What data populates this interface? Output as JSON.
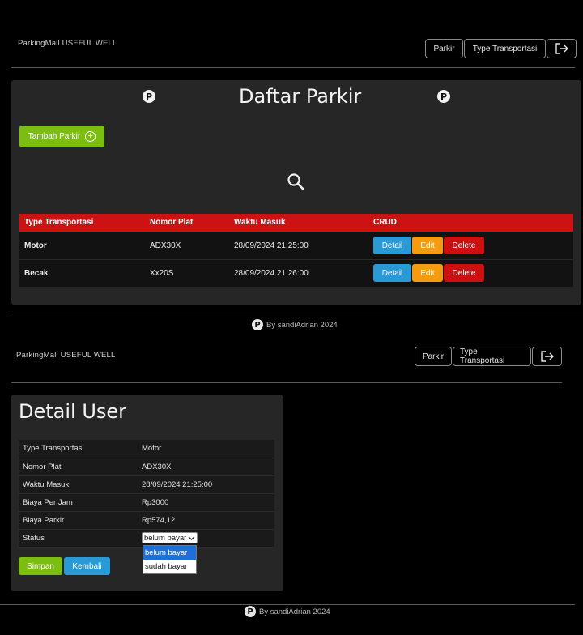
{
  "top": {
    "brand": "ParkingMall USEFUL WELL",
    "nav": {
      "parkir": "Parkir",
      "type": "Type Transportasi",
      "logout_icon": "logout-icon"
    },
    "title": "Daftar Parkir",
    "add_button": "Tambah Parkir",
    "search_icon": "search-icon",
    "table": {
      "headers": [
        "Type Transportasi",
        "Nomor Plat",
        "Waktu Masuk",
        "CRUD"
      ],
      "rows": [
        {
          "type": "Motor",
          "plate": "ADX30X",
          "time": "28/09/2024 21:25:00"
        },
        {
          "type": "Becak",
          "plate": "Xx20S",
          "time": "28/09/2024 21:26:00"
        }
      ],
      "actions": {
        "detail": "Detail",
        "edit": "Edit",
        "delete": "Delete"
      }
    },
    "footer": "By  sandiAdrian 2024"
  },
  "bottom": {
    "brand": "ParkingMall USEFUL WELL",
    "nav": {
      "parkir": "Parkir",
      "type": "Type Transportasi"
    },
    "title": "Detail User",
    "fields": [
      {
        "label": "Type Transportasi",
        "value": "Motor"
      },
      {
        "label": "Nomor Plat",
        "value": "ADX30X"
      },
      {
        "label": "Waktu Masuk",
        "value": "28/09/2024 21:25:00"
      },
      {
        "label": "Biaya Per Jam",
        "value": "Rp3000"
      },
      {
        "label": "Biaya Parkir",
        "value": "Rp574,12"
      }
    ],
    "status_label": "Status",
    "status_selected": "belum bayar",
    "status_options": [
      "belum bayar",
      "sudah bayar"
    ],
    "save_button": "Simpan",
    "back_button": "Kembali",
    "footer": "By  sandiAdrian 2024"
  },
  "colors": {
    "green": "#7cbd12",
    "red": "#cc1212",
    "blue": "#2a9ad6",
    "orange": "#f59b12"
  }
}
